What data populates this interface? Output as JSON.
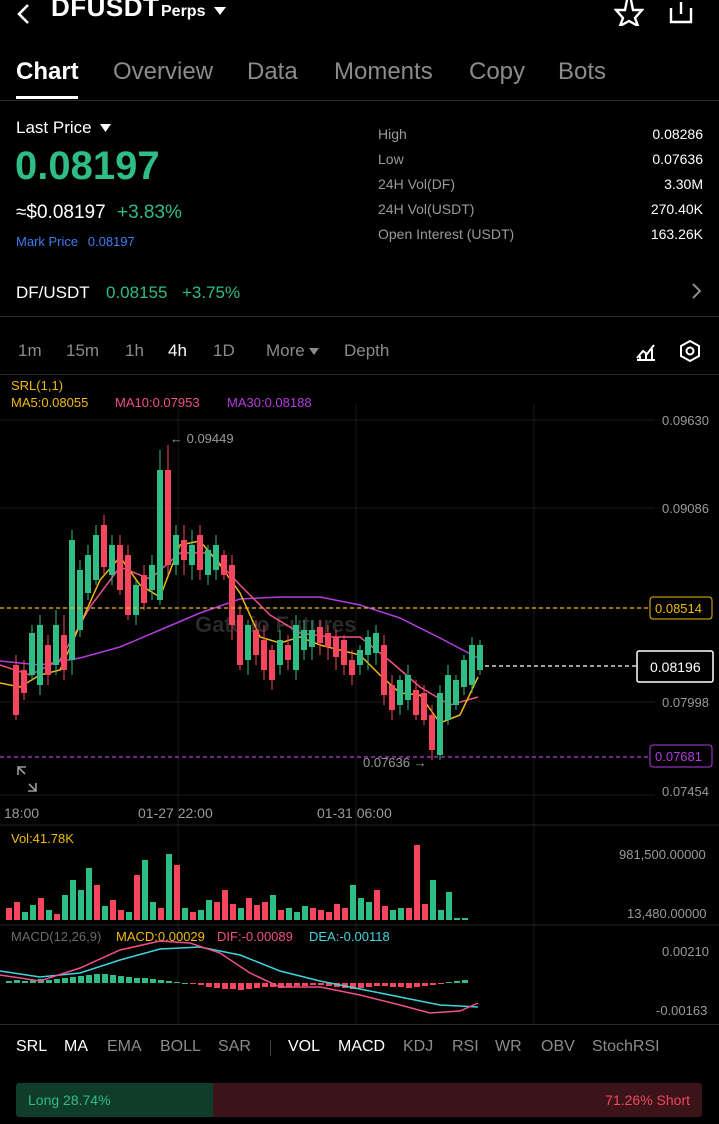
{
  "header": {
    "pair": "DFUSDT",
    "market_type": "Perps"
  },
  "tabs": [
    "Chart",
    "Overview",
    "Data",
    "Moments",
    "Copy",
    "Bots"
  ],
  "price": {
    "last_price_label": "Last Price",
    "last_price": "0.08197",
    "approx": "≈$0.08197",
    "change": "+3.83%",
    "mark_label": "Mark Price",
    "mark_value": "0.08197"
  },
  "stats": [
    {
      "label": "High",
      "value": "0.08286"
    },
    {
      "label": "Low",
      "value": "0.07636"
    },
    {
      "label": "24H Vol(DF)",
      "value": "3.30M"
    },
    {
      "label": "24H Vol(USDT)",
      "value": "270.40K"
    },
    {
      "label": "Open Interest (USDT)",
      "value": "163.26K"
    }
  ],
  "spot": {
    "pair": "DF/USDT",
    "price": "0.08155",
    "change": "+3.75%"
  },
  "intervals": [
    "1m",
    "15m",
    "1h",
    "4h",
    "1D",
    "More",
    "Depth"
  ],
  "active_interval": "4h",
  "chart": {
    "srl": "SRL(1,1)",
    "ma5": "MA5:0.08055",
    "ma10": "MA10:0.07953",
    "ma30": "MA30:0.08188",
    "watermark": "Gate.io Futures",
    "price_axis": [
      "0.09630",
      "0.09086",
      "0.08514",
      "0.08196",
      "0.07998",
      "0.07681",
      "0.07454"
    ],
    "time_axis": [
      "18:00",
      "01-27 22:00",
      "01-31 06:00"
    ],
    "high_marker": "← 0.09449",
    "low_marker": "0.07636 →",
    "volume_label": "Vol:41.78K",
    "volume_axis": [
      "981,500.00000",
      "13,480.00000"
    ],
    "macd_params": "MACD(12,26,9)",
    "macd": "MACD:0.00029",
    "dif": "DIF:-0.00089",
    "dea": "DEA:-0.00118",
    "macd_axis": [
      "0.00210",
      "-0.00163"
    ],
    "colors": {
      "up": "#2ebd85",
      "down": "#f6465d",
      "ma5": "#f0b90b",
      "ma10": "#f0508c",
      "ma30": "#b43cdc"
    }
  },
  "indicators": [
    "SRL",
    "MA",
    "EMA",
    "BOLL",
    "SAR",
    "VOL",
    "MACD",
    "KDJ",
    "RSI",
    "WR",
    "OBV",
    "StochRSI"
  ],
  "active_indicators": [
    "SRL",
    "MA",
    "VOL",
    "MACD"
  ],
  "long_short": {
    "long": "Long 28.74%",
    "short": "71.26% Short",
    "long_pct": 28.74
  }
}
